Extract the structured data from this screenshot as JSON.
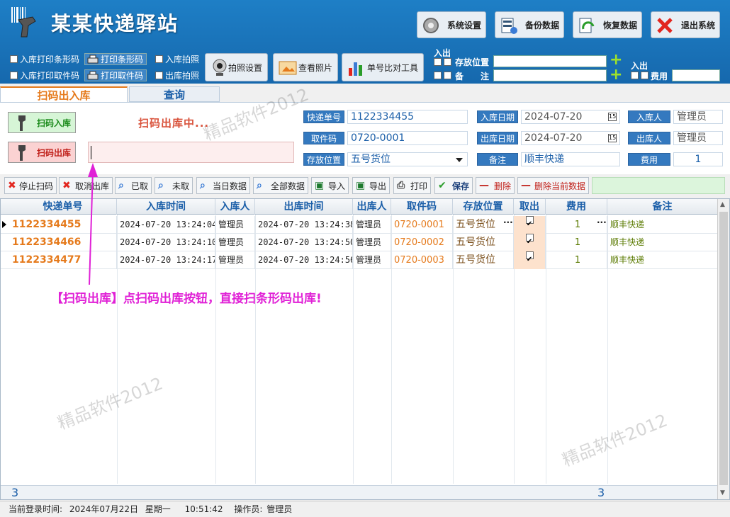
{
  "app": {
    "title": "某某快递驿站"
  },
  "header": {
    "buttons": [
      {
        "label": "系统设置",
        "icon": "gear-icon"
      },
      {
        "label": "备份数据",
        "icon": "database-backup-icon"
      },
      {
        "label": "恢复数据",
        "icon": "restore-icon"
      },
      {
        "label": "退出系统",
        "icon": "close-icon"
      }
    ],
    "options": {
      "print_barcode_in": "入库打印条形码",
      "print_pickup_in": "入库打印取件码",
      "print_barcode_btn": "打印条形码",
      "print_pickup_btn": "打印取件码",
      "photo_in": "入库拍照",
      "photo_out": "出库拍照",
      "photo_settings": "拍照设置",
      "view_photos": "查看照片",
      "compare_tool": "单号比对工具"
    },
    "inout_label_1": "入出",
    "inout_label_2": "入出",
    "storage_label": "存放位置",
    "note_label": "备　　注",
    "fee_label": "费用"
  },
  "tabs": [
    {
      "label": "扫码出入库",
      "active": true
    },
    {
      "label": "查询",
      "active": false
    }
  ],
  "scan": {
    "in_button": "扫码入库",
    "out_button": "扫码出库",
    "status": "扫码出库中..."
  },
  "form": {
    "tracking_label": "快递单号",
    "tracking_value": "1122334455",
    "pickup_label": "取件码",
    "pickup_value": "0720-0001",
    "location_label": "存放位置",
    "location_value": "五号货位",
    "in_date_label": "入库日期",
    "in_date_value": "2024-07-20",
    "out_date_label": "出库日期",
    "out_date_value": "2024-07-20",
    "note_label": "备注",
    "note_value": "顺丰快递",
    "in_person_label": "入库人",
    "in_person_value": "管理员",
    "out_person_label": "出库人",
    "out_person_value": "管理员",
    "fee_label": "费用",
    "fee_value": "1"
  },
  "toolbar": [
    {
      "label": "停止扫码",
      "icon": "stop-icon"
    },
    {
      "label": "取消出库",
      "icon": "cancel-icon"
    },
    {
      "label": "已取",
      "icon": "search-doc-icon"
    },
    {
      "label": "未取",
      "icon": "search-doc-icon"
    },
    {
      "label": "当日数据",
      "icon": "search-doc-icon"
    },
    {
      "label": "全部数据",
      "icon": "search-doc-icon"
    },
    {
      "label": "导入",
      "icon": "excel-icon"
    },
    {
      "label": "导出",
      "icon": "excel-icon"
    },
    {
      "label": "打印",
      "icon": "printer-icon"
    },
    {
      "label": "保存",
      "icon": "check-icon"
    },
    {
      "label": "删除",
      "icon": "minus-icon"
    },
    {
      "label": "删除当前数据",
      "icon": "minus-icon"
    }
  ],
  "grid": {
    "columns": [
      "快递单号",
      "入库时间",
      "入库人",
      "出库时间",
      "出库人",
      "取件码",
      "存放位置",
      "取出",
      "费用",
      "备注"
    ],
    "rows": [
      {
        "tracking": "1122334455",
        "in_time": "2024-07-20 13:24:04",
        "in_person": "管理员",
        "out_time": "2024-07-20 13:24:38",
        "out_person": "管理员",
        "pickup": "0720-0001",
        "location": "五号货位",
        "taken": true,
        "fee": "1",
        "note": "顺丰快递"
      },
      {
        "tracking": "1122334466",
        "in_time": "2024-07-20 13:24:10",
        "in_person": "管理员",
        "out_time": "2024-07-20 13:24:50",
        "out_person": "管理员",
        "pickup": "0720-0002",
        "location": "五号货位",
        "taken": true,
        "fee": "1",
        "note": "顺丰快递"
      },
      {
        "tracking": "1122334477",
        "in_time": "2024-07-20 13:24:17",
        "in_person": "管理员",
        "out_time": "2024-07-20 13:24:56",
        "out_person": "管理员",
        "pickup": "0720-0003",
        "location": "五号货位",
        "taken": true,
        "fee": "1",
        "note": "顺丰快递"
      }
    ],
    "footer_count": "3",
    "footer_fee_total": "3"
  },
  "annotation": "【扫码出库】点扫码出库按钮，直接扫条形码出库!",
  "watermark": "精品软件2012",
  "statusbar": {
    "login_label": "当前登录时间:",
    "login_date": "2024年07月22日",
    "weekday": "星期一",
    "time": "10:51:42",
    "operator_label": "操作员:",
    "operator": "管理员"
  },
  "colors": {
    "header": "#1e7fc6",
    "accent": "#e57a1c",
    "link": "#1a5ea8",
    "annotation": "#e021d6"
  }
}
